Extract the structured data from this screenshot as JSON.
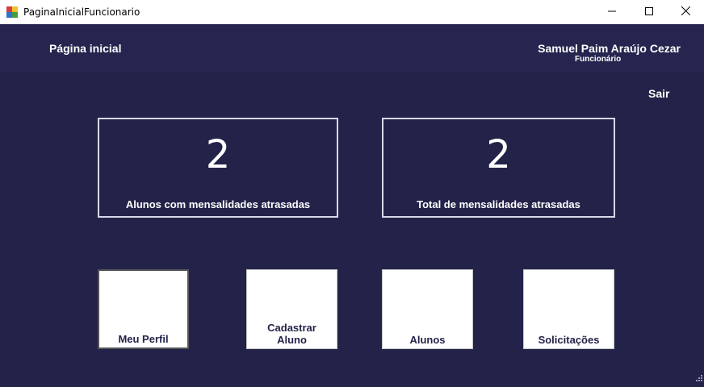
{
  "window": {
    "title": "PaginaInicialFuncionario",
    "icon": "app-form-icon",
    "controls": [
      "minimize-icon",
      "maximize-icon",
      "close-icon"
    ]
  },
  "header": {
    "page_label": "Página inicial",
    "user_name": "Samuel Paim Araújo Cezar",
    "user_role": "Funcionário"
  },
  "main": {
    "logout_label": "Sair",
    "stats": [
      {
        "value": "2",
        "label": "Alunos com mensalidades atrasadas"
      },
      {
        "value": "2",
        "label": "Total de mensalidades atrasadas"
      }
    ],
    "tiles": [
      {
        "label": "Meu Perfil"
      },
      {
        "label": "Cadastrar Aluno"
      },
      {
        "label": "Alunos"
      },
      {
        "label": "Solicitações"
      }
    ]
  },
  "colors": {
    "background": "#23234a",
    "header": "#25254f",
    "text": "#ffffff",
    "tile_bg": "#ffffff",
    "tile_text": "#23234a"
  }
}
